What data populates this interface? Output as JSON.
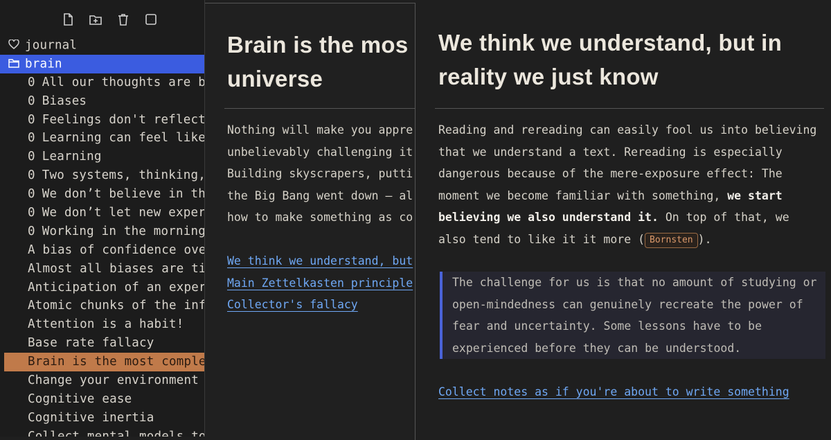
{
  "toolbar": {
    "icons": [
      "new-file-icon",
      "new-folder-icon",
      "trash-icon",
      "grid-icon"
    ]
  },
  "tree": {
    "folders": [
      {
        "label": "journal",
        "icon": "heart-icon"
      },
      {
        "label": "brain",
        "icon": "folder-icon"
      }
    ],
    "notes": [
      {
        "count": "0",
        "label": "All our thoughts are b"
      },
      {
        "count": "0",
        "label": "Biases"
      },
      {
        "count": "0",
        "label": "Feelings don't reflect"
      },
      {
        "count": "0",
        "label": "Learning can feel like"
      },
      {
        "count": "0",
        "label": "Learning"
      },
      {
        "count": "0",
        "label": "Two systems, thinking,"
      },
      {
        "count": "0",
        "label": "We don’t believe in the"
      },
      {
        "count": "0",
        "label": "We don’t let new exper"
      },
      {
        "count": "0",
        "label": "Working in the morning"
      }
    ],
    "pages": [
      "A bias of confidence ove",
      "Almost all biases are ti",
      "Anticipation of an exper",
      "Atomic chunks of the inf",
      "Attention is a habit!",
      "Base rate fallacy",
      "Brain is the most comple",
      "Change your environment",
      "Cognitive ease",
      "Cognitive inertia",
      "Collect mental models to"
    ],
    "selected_page": "Brain is the most comple"
  },
  "pane1": {
    "title_line1": "Brain is the mos",
    "title_line2": "universe",
    "body": [
      "Nothing will make you appre",
      "unbelievably challenging it",
      "Building skyscrapers, putti",
      "the Big Bang went down – al",
      "how to make something as co"
    ],
    "links": [
      "We think we understand, but",
      "Main Zettelkasten principle",
      "Collector's fallacy"
    ]
  },
  "pane2": {
    "title_line1": "We think we understand, but in",
    "title_line2": "reality we just know",
    "body": {
      "line1": "Reading and rereading can easily fool us into believing",
      "line2": "that we understand a text. Rereading is especially",
      "line3": "dangerous because of the mere-exposure effect: The",
      "line4_plain": "moment we become familiar with something, ",
      "line4_bold": "we start",
      "line5_bold": "believing we also understand it.",
      "line5_plain": " On top of that, we",
      "line6_pre": "also tend to like it it more (",
      "tag": "Bornsten",
      "line6_post": ")."
    },
    "quote": [
      "The challenge for us is that no amount of studying or",
      "open-mindedness can genuinely recreate the power of",
      "fear and  uncertainty. Some lessons have to be",
      "experienced before they can be understood."
    ],
    "link": "Collect notes as if you're about to write something"
  },
  "colors": {
    "selection_blue": "#3b5ce0",
    "selection_orange": "#c07a4a",
    "link": "#6fa8f5",
    "quote_border": "#4a63d8"
  }
}
